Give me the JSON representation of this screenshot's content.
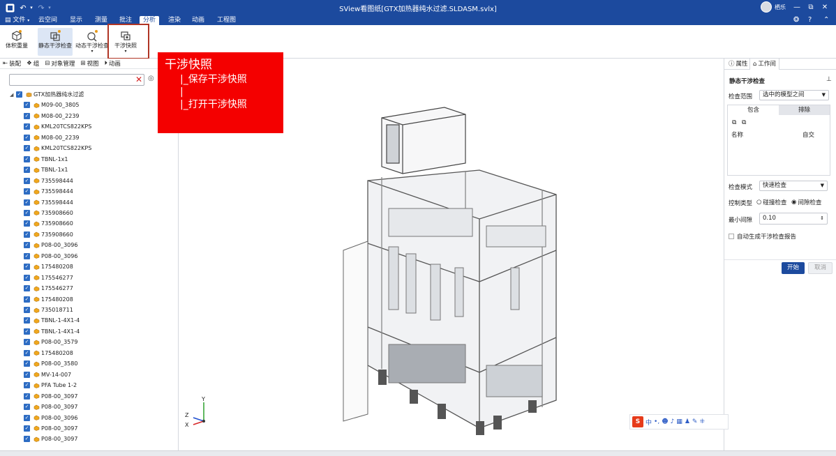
{
  "titlebar": {
    "app_title": "SView看图纸[GTX加热器纯水过滤.SLDASM.svlx]",
    "user_name": "栖乐",
    "window_buttons": [
      "—",
      "⧉",
      "✕"
    ]
  },
  "menubar": {
    "file": "文件",
    "items": [
      "云空间",
      "显示",
      "测量",
      "批注",
      "分析",
      "渲染",
      "动画",
      "工程图"
    ],
    "active": "分析"
  },
  "ribbon": {
    "buttons": [
      "体积重量",
      "静态干涉检查",
      "动态干涉检查",
      "干涉快照"
    ],
    "selected": "静态干涉检查"
  },
  "tooltip": {
    "title": "干涉快照",
    "line1": "|_保存干涉快照",
    "line2": "|",
    "line3": "|_打开干涉快照"
  },
  "left_panel": {
    "tabs": [
      "装配",
      "组",
      "对象管理",
      "视图",
      "动画"
    ],
    "search_value": "",
    "root": "GTX加热器纯水过滤",
    "parts": [
      "M09-00_3805",
      "M08-00_2239",
      "KML20TCS822KPS",
      "M08-00_2239",
      "KML20TCS822KPS",
      "TBNL-1x1",
      "TBNL-1x1",
      "735598444",
      "735598444",
      "735598444",
      "735908660",
      "735908660",
      "735908660",
      "P08-00_3096",
      "P08-00_3096",
      "175480208",
      "175546277",
      "175546277",
      "175480208",
      "735018711",
      "TBNL-1-4X1-4",
      "TBNL-1-4X1-4",
      "P08-00_3579",
      "175480208",
      "P08-00_3580",
      "MV-14-007",
      "PFA Tube 1-2",
      "P08-00_3097",
      "P08-00_3097",
      "P08-00_3096",
      "P08-00_3097",
      "P08-00_3097"
    ]
  },
  "viewport": {
    "axis_labels": [
      "Y",
      "Z",
      "X"
    ]
  },
  "right_panel": {
    "tabs": [
      "属性",
      "工作间"
    ],
    "section_title": "静态干涉检查",
    "scope_label": "检查范围",
    "scope_value": "选中的模型之间",
    "include_tab": "包含",
    "exclude_tab": "排除",
    "col_name": "名称",
    "col_self": "自交",
    "mode_label": "检查模式",
    "mode_value": "快速检查",
    "control_label": "控制类型",
    "control_opt1": "碰撞检查",
    "control_opt2": "间隙检查",
    "control_selected": "间隙检查",
    "min_gap_label": "最小间隙",
    "min_gap_value": "0.10",
    "auto_report_label": "自动生成干涉检查报告",
    "start_button": "开始",
    "cancel_button": "取消"
  },
  "ime": {
    "logo": "S",
    "lang": "中"
  },
  "colors": {
    "primary": "#1c4a9e",
    "tooltip_red": "#f40000",
    "highlight": "#b03525",
    "checkbox": "#2d6cc3"
  }
}
